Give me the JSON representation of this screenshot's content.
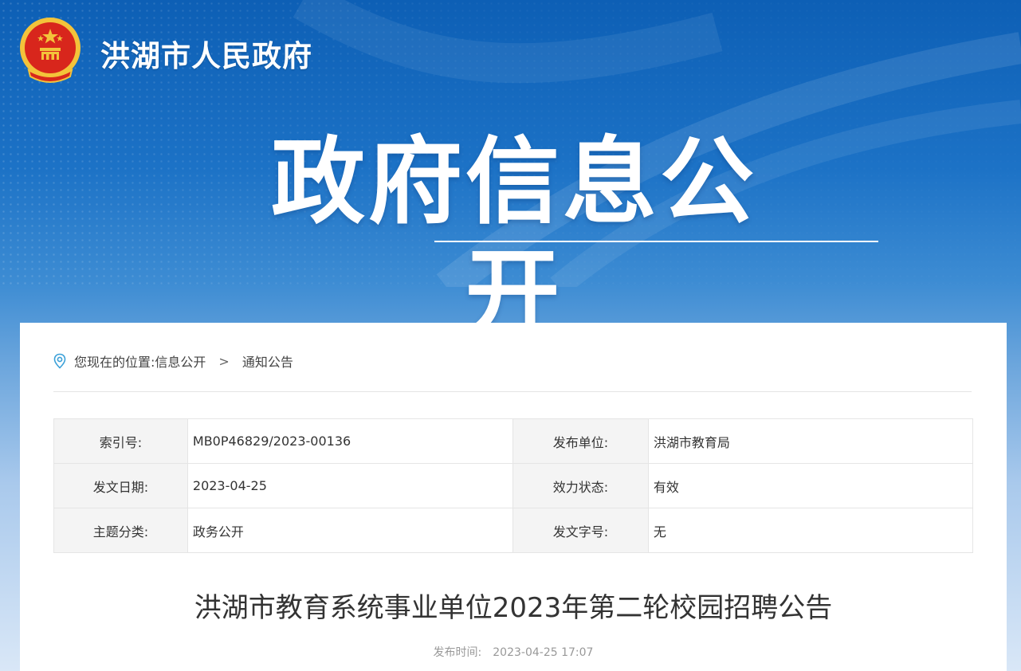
{
  "header": {
    "site_name": "洪湖市人民政府",
    "banner": "政府信息公开",
    "emblem_icon": "national-emblem-icon"
  },
  "breadcrumb": {
    "prefix": "您现在的位置:",
    "items": [
      "信息公开",
      "通知公告"
    ],
    "separator": ">",
    "icon": "location-pin-icon"
  },
  "meta": {
    "index_label": "索引号:",
    "index_value": "MB0P46829/2023-00136",
    "publisher_label": "发布单位:",
    "publisher_value": "洪湖市教育局",
    "date_label": "发文日期:",
    "date_value": "2023-04-25",
    "status_label": "效力状态:",
    "status_value": "有效",
    "topic_label": "主题分类:",
    "topic_value": "政务公开",
    "docnum_label": "发文字号:",
    "docnum_value": "无"
  },
  "article": {
    "title": "洪湖市教育系统事业单位2023年第二轮校园招聘公告",
    "pub_label": "发布时间:",
    "pub_time": "2023-04-25 17:07"
  },
  "colors": {
    "header_blue": "#0d5fb5",
    "emblem_red": "#d8261c",
    "emblem_gold": "#f3c33a"
  }
}
